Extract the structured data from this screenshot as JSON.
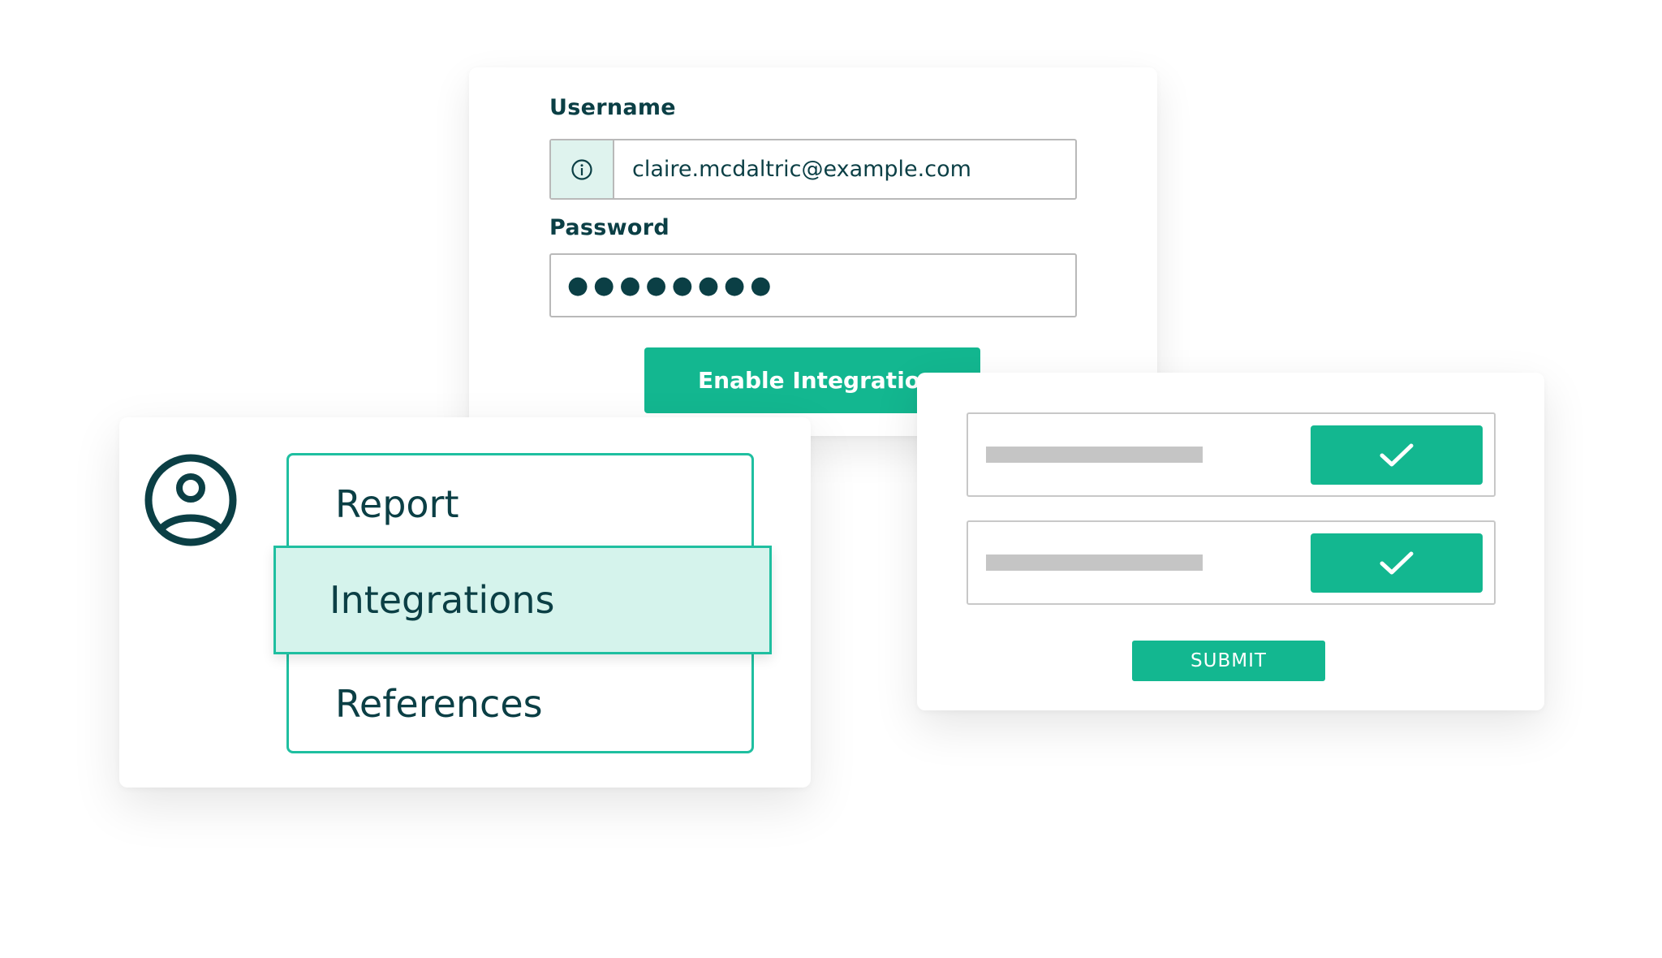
{
  "login_form": {
    "username_label": "Username",
    "username_value": "claire.mcdaltric@example.com",
    "password_label": "Password",
    "password_value": "●●●●●●●●",
    "enable_button_label": "Enable Integration",
    "info_icon": "info-icon"
  },
  "menu": {
    "avatar_icon": "user-avatar-icon",
    "items": [
      {
        "label": "Report"
      },
      {
        "label": "Integrations",
        "selected": true
      },
      {
        "label": "References"
      }
    ]
  },
  "checklist": {
    "rows": [
      {
        "checked": true,
        "icon": "checkmark-icon"
      },
      {
        "checked": true,
        "icon": "checkmark-icon"
      }
    ],
    "submit_label": "SUBMIT"
  },
  "colors": {
    "accent": "#13b790",
    "accent_light": "#d5f3ec",
    "text_dark": "#0b3f45",
    "border_gray": "#b9b9b9",
    "placeholder_gray": "#c5c5c5"
  }
}
